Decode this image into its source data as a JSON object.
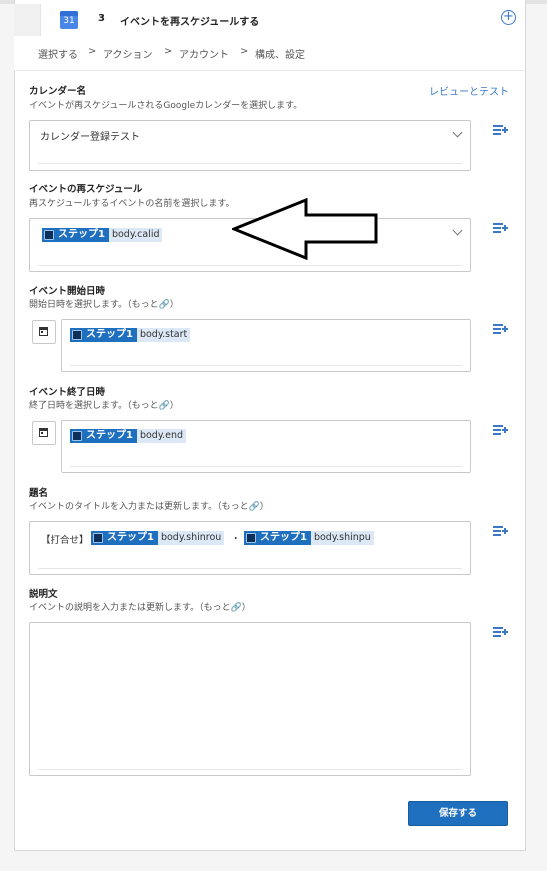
{
  "step": {
    "icon_text": "31",
    "number": "3",
    "title": "イベントを再スケジュールする"
  },
  "breadcrumb": [
    "選択する",
    "アクション",
    "アカウント",
    "構成、設定"
  ],
  "review_link": "レビューとテスト",
  "fields": {
    "calendar": {
      "label": "カレンダー名",
      "desc": "イベントが再スケジュールされるGoogleカレンダーを選択します。",
      "value": "カレンダー登録テスト"
    },
    "reschedule": {
      "label": "イベントの再スケジュール",
      "desc": "再スケジュールするイベントの名前を選択します。",
      "step": "ステップ1",
      "var": "body.calid"
    },
    "start": {
      "label": "イベント開始日時",
      "desc": "開始日時を選択します。（もっと🔗）",
      "step": "ステップ1",
      "var": "body.start"
    },
    "end": {
      "label": "イベント終了日時",
      "desc": "終了日時を選択します。（もっと🔗）",
      "step": "ステップ1",
      "var": "body.end"
    },
    "title": {
      "label": "題名",
      "desc": "イベントのタイトルを入力または更新します。（もっと🔗）",
      "prefix": "【打合せ】",
      "step1": "ステップ1",
      "var1": "body.shinrou",
      "dot": "・",
      "step2": "ステップ1",
      "var2": "body.shinpu"
    },
    "description": {
      "label": "説明文",
      "desc": "イベントの説明を入力または更新します。（もっと🔗）"
    }
  },
  "save_label": "保存する",
  "colors": {
    "accent": "#1f6fbf",
    "link": "#3a78c9",
    "pill_bg": "#dce8f5"
  },
  "icons": [
    "calendar-icon",
    "add-circle-icon",
    "chevron-down-icon",
    "date-picker-icon",
    "insert-variable-icon",
    "arrow-annotation"
  ]
}
